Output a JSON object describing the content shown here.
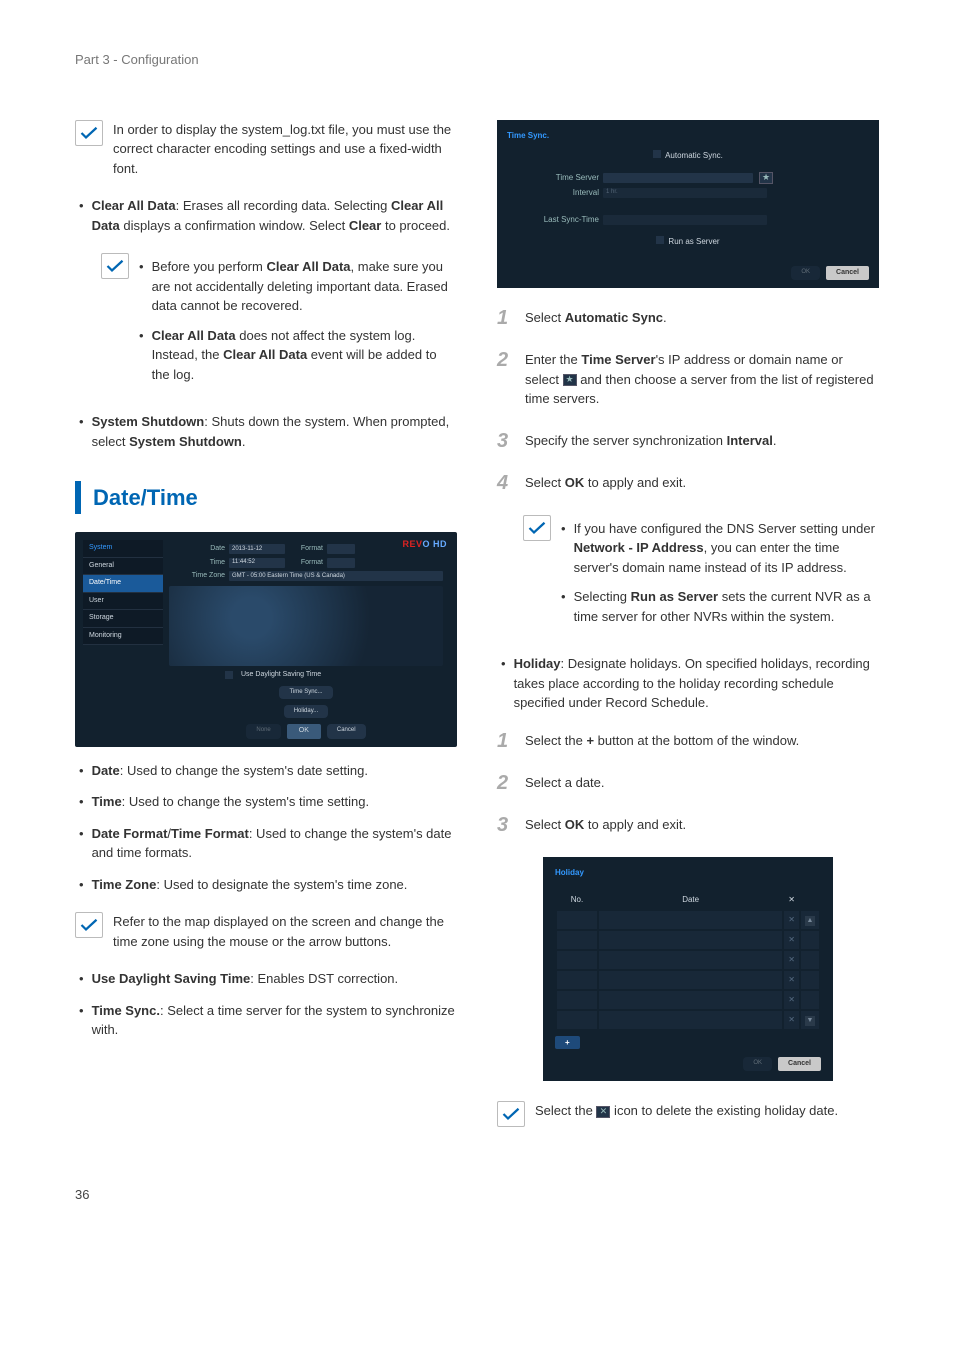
{
  "header": "Part 3 - Configuration",
  "page_num": "36",
  "left": {
    "note_syslog": "In order to display the system_log.txt file, you must use the correct character encoding settings and use a fixed-width font.",
    "clear_all_label": "Clear All Data",
    "clear_all_text": ": Erases all recording data. Selecting ",
    "clear_all_bold2": "Clear All Data",
    "clear_all_text2": " displays a confirmation window. Select ",
    "clear_bold": "Clear",
    "clear_all_text3": " to proceed.",
    "note_clear1a": "Before you perform ",
    "note_clear1b": "Clear All Data",
    "note_clear1c": ", make sure you are not accidentally deleting important data. Erased data cannot be recovered.",
    "note_clear2a": "Clear All Data",
    "note_clear2b": " does not affect the system log. Instead, the ",
    "note_clear2c": "Clear All Data",
    "note_clear2d": " event will be added to the log.",
    "shutdown_label": "System Shutdown",
    "shutdown_text1": ": Shuts down the system. When prompted, select ",
    "shutdown_bold": "System Shutdown",
    "h2": "Date/Time",
    "shot": {
      "brand1": "REV",
      "brand2": "O HD",
      "side_hdr": "System",
      "side_items": [
        "General",
        "Date/Time",
        "User",
        "Storage",
        "Monitoring"
      ],
      "date_label": "Date",
      "date_val": "2013-11-12",
      "format_label": "Format",
      "time_label": "Time",
      "time_val": "11:44:52",
      "tz_label": "Time Zone",
      "tz_val": "GMT - 05:00  Eastern Time (US & Canada)",
      "dst": "Use Daylight Saving Time",
      "btn_timesync": "Time Sync...",
      "btn_holiday": "Holiday...",
      "btn_none": "None",
      "btn_ok": "OK",
      "btn_cancel": "Cancel"
    },
    "b_date_lbl": "Date",
    "b_date_txt": ": Used to change the system's date setting.",
    "b_time_lbl": "Time",
    "b_time_txt": ": Used to change the system's time setting.",
    "b_fmt_lbl": "Date Format",
    "b_fmt_slash": "/",
    "b_fmt_lbl2": "Time Format",
    "b_fmt_txt": ": Used to change the system's date and time formats.",
    "b_tz_lbl": "Time Zone",
    "b_tz_txt": ": Used to designate the system's time zone.",
    "note_tz": "Refer to the map displayed on the screen and change the time zone using the mouse or the arrow buttons.",
    "b_dst_lbl": "Use Daylight Saving Time",
    "b_dst_txt": ": Enables DST correction.",
    "b_ts_lbl": "Time Sync.",
    "b_ts_txt": ": Select a time server for the system to synchronize with."
  },
  "right": {
    "shot": {
      "title": "Time Sync.",
      "auto": "Automatic Sync.",
      "server_lbl": "Time Server",
      "interval_lbl": "Interval",
      "interval_val": "1 hr.",
      "last_lbl": "Last Sync-Time",
      "last_val": "",
      "runas": "Run as Server",
      "ok": "OK",
      "cancel": "Cancel"
    },
    "step1a": "Select ",
    "step1b": "Automatic Sync",
    "step1c": ".",
    "step2a": "Enter the ",
    "step2b": "Time Server",
    "step2c": "'s IP address or domain name or select ",
    "step2d": " and then choose a server from the list of registered time servers.",
    "step3a": "Specify the server synchronization ",
    "step3b": "Interval",
    "step3c": ".",
    "step4a": "Select ",
    "step4b": "OK",
    "step4c": " to apply and exit.",
    "note_dns1": "If you have configured the DNS Server setting under ",
    "note_dns2": "Network - IP Address",
    "note_dns3": ", you can enter the time server's domain name instead of its IP address.",
    "note_run1": "Selecting ",
    "note_run2": "Run as Server",
    "note_run3": " sets the current NVR as a time server for other NVRs within the system.",
    "holiday_lbl": "Holiday",
    "holiday_txt": ": Designate holidays. On specified holidays, recording takes place according to the holiday recording schedule specified under Record Schedule.",
    "h_step1a": "Select the ",
    "h_step1b": "+",
    "h_step1c": " button at the bottom of the window.",
    "h_step2": "Select a date.",
    "h_step3a": "Select ",
    "h_step3b": "OK",
    "h_step3c": " to apply and exit.",
    "shot3": {
      "title": "Holiday",
      "no": "No.",
      "date": "Date",
      "x": "✕",
      "plus": "+",
      "ok": "OK",
      "cancel": "Cancel"
    },
    "note_del1": "Select the ",
    "note_del2": " icon to delete the existing holiday date."
  }
}
